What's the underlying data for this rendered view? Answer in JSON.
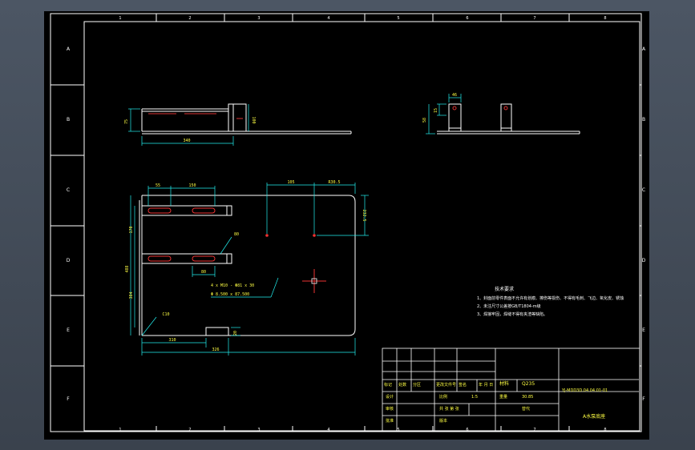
{
  "frame": {
    "row_labels": [
      "A",
      "B",
      "C",
      "D",
      "E",
      "F"
    ],
    "col_labels": [
      "1",
      "2",
      "3",
      "4",
      "5",
      "6",
      "7",
      "8"
    ]
  },
  "front_view": {
    "dims": [
      "340",
      "100",
      "75"
    ]
  },
  "side_view": {
    "dims": [
      "46",
      "15",
      "58"
    ]
  },
  "plan_view": {
    "dims": [
      "55",
      "150",
      "105",
      "R30.5",
      "170",
      "80",
      "80",
      "488",
      "384",
      "C10",
      "310",
      "20",
      "326",
      "232.5"
    ],
    "hole_note_1": "4 x M10 - Φ81 x 30",
    "hole_note_2": "Φ 8.500 x 87.500"
  },
  "tech_notes": {
    "title": "技术要求",
    "lines": [
      "1、封面前零件表面不允许有划痕、擦伤等损伤、不得有毛刺、飞边、氧化皮、锈蚀",
      "2、未注尺寸公差按GB/T1804-m级",
      "3、焊接牢固，焊缝不得有夹渣等缺陷。"
    ]
  },
  "title_block": {
    "material_label": "材料",
    "material": "Q235",
    "drawing_no": "YJ-MDD3D.04.04.01-01",
    "header_cells": [
      "标记",
      "处数",
      "分区",
      "更改文件号",
      "签名",
      "年 月 日"
    ],
    "design": "设计",
    "check": "审核",
    "approve": "批准",
    "scale_label": "比例",
    "scale": "1:5",
    "weight_label": "重量",
    "weight": "30.85",
    "sheet_label": "共  张  第  张",
    "version_label": "版本",
    "replace_label": "替代",
    "part_name": "A水泵底座"
  }
}
